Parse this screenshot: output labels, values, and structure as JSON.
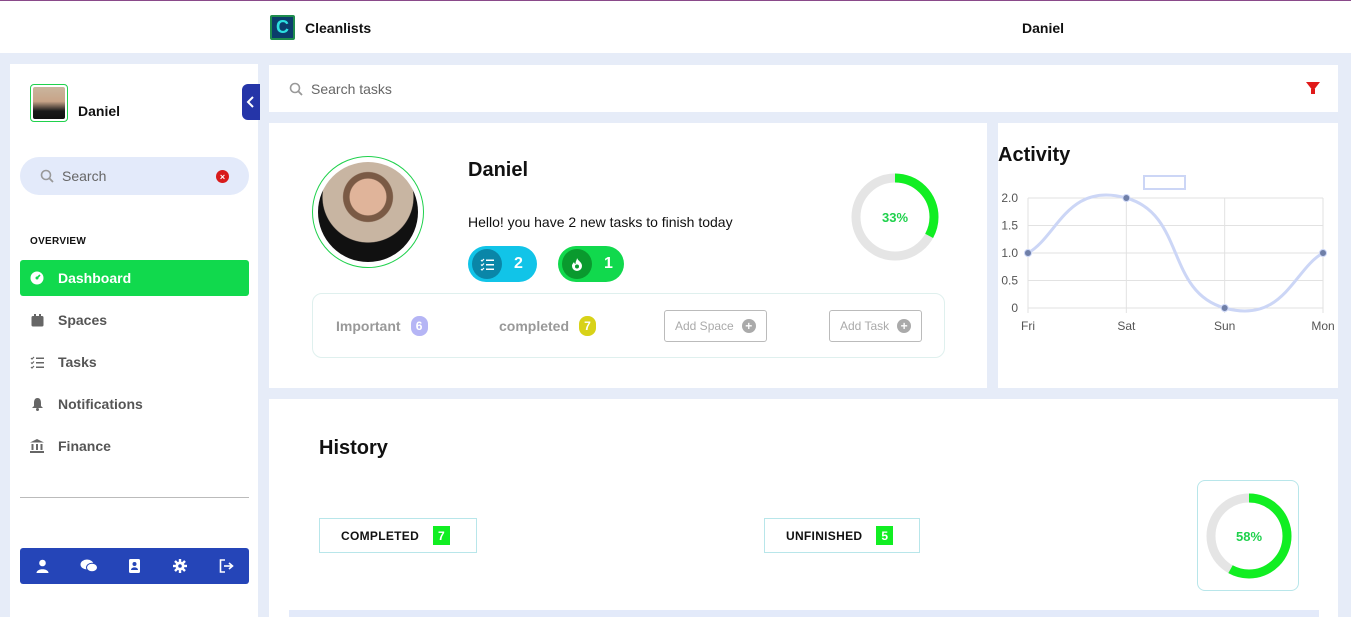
{
  "app": {
    "name": "Cleanlists",
    "logo_letter": "C",
    "current_user": "Daniel"
  },
  "sidebar": {
    "user_name": "Daniel",
    "search_placeholder": "Search",
    "section_label": "OVERVIEW",
    "items": [
      {
        "label": "Dashboard",
        "icon": "dashboard-icon",
        "active": true
      },
      {
        "label": "Spaces",
        "icon": "calendar-icon",
        "active": false
      },
      {
        "label": "Tasks",
        "icon": "tasks-list-icon",
        "active": false
      },
      {
        "label": "Notifications",
        "icon": "bell-icon",
        "active": false
      },
      {
        "label": "Finance",
        "icon": "bank-icon",
        "active": false
      }
    ],
    "bottom_icons": [
      "user-icon",
      "chat-icon",
      "contacts-icon",
      "settings-icon",
      "logout-icon"
    ]
  },
  "task_search": {
    "placeholder": "Search tasks"
  },
  "profile": {
    "name": "Daniel",
    "message": "Hello! you have 2 new tasks to finish today",
    "tasks_count": "2",
    "streak_count": "1",
    "progress_label": "33%",
    "progress_value": 0.33,
    "important_label": "Important",
    "important_count": "6",
    "completed_label": "completed",
    "completed_count": "7",
    "add_space_label": "Add Space",
    "add_task_label": "Add Task"
  },
  "activity": {
    "title": "Activity",
    "chart_data": {
      "type": "line",
      "title": "Activity",
      "categories": [
        "Fri",
        "Sat",
        "Sun",
        "Mon"
      ],
      "series": [
        {
          "values": [
            1,
            2,
            0,
            1
          ]
        }
      ],
      "y_ticks": [
        "0",
        "0.5",
        "1.0",
        "1.5",
        "2.0"
      ],
      "ylim": [
        0,
        2
      ],
      "grid": true,
      "line_color": "#ccd6f6"
    }
  },
  "history": {
    "title": "History",
    "completed_label": "COMPLETED",
    "completed_count": "7",
    "unfinished_label": "UNFINISHED",
    "unfinished_count": "5",
    "progress_label": "58%",
    "progress_value": 0.58
  },
  "colors": {
    "accent_green": "#11d94d",
    "accent_blue": "#2545b8",
    "cyan": "#11c4e8"
  }
}
